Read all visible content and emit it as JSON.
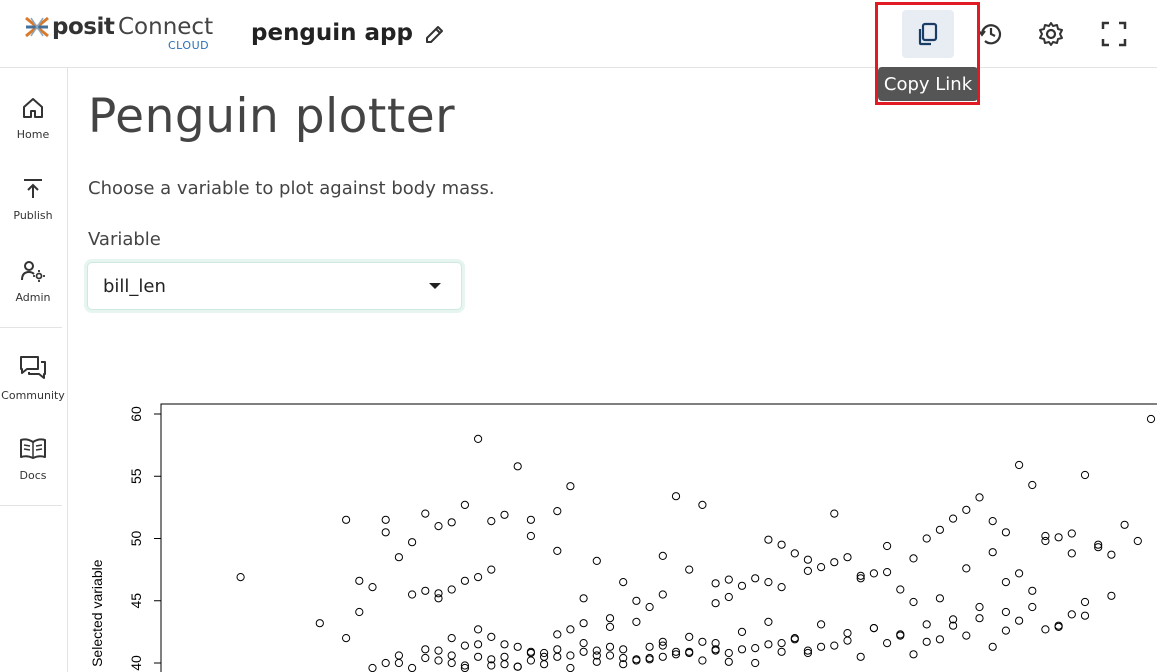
{
  "header": {
    "logo_posit": "posit",
    "logo_connect": "Connect",
    "logo_cloud": "CLOUD",
    "app_title": "penguin app",
    "tooltip": "Copy Link",
    "icons": [
      "edit-icon",
      "copy-icon",
      "history-icon",
      "gear-icon",
      "fullscreen-icon"
    ]
  },
  "sidebar": {
    "items": [
      {
        "label": "Home",
        "icon": "home-icon"
      },
      {
        "label": "Publish",
        "icon": "upload-icon"
      },
      {
        "label": "Admin",
        "icon": "admin-icon"
      },
      {
        "label": "Community",
        "icon": "chat-icon"
      },
      {
        "label": "Docs",
        "icon": "book-icon"
      }
    ]
  },
  "main": {
    "title": "Penguin plotter",
    "description": "Choose a variable to plot against body mass.",
    "variable_label": "Variable",
    "variable_value": "bill_len"
  },
  "chart_data": {
    "type": "scatter",
    "title": "",
    "xlabel": "",
    "ylabel": "Selected variable",
    "ylim": [
      39.5,
      61
    ],
    "yticks": [
      40,
      45,
      50,
      55,
      60
    ],
    "xlim": [
      2700,
      6300
    ],
    "grid": false,
    "x": [
      2850,
      3150,
      3950,
      4050,
      3400,
      3350,
      3550,
      3600,
      3650,
      3800,
      3750,
      3700,
      3900,
      3850,
      3950,
      3450,
      3500,
      3300,
      3250,
      3400,
      4050,
      4100,
      4150,
      4200,
      3700,
      3750,
      3800,
      3500,
      3550,
      3600,
      3650,
      4250,
      4300,
      4350,
      4450,
      4500,
      4550,
      4600,
      4650,
      4700,
      4750,
      4800,
      4850,
      4900,
      4950,
      5000,
      5050,
      5100,
      5150,
      5200,
      5250,
      5300,
      5350,
      5400,
      5450,
      5500,
      5550,
      5600,
      5650,
      5700,
      5750,
      5800,
      5850,
      5900,
      5950,
      6000,
      6050,
      6100,
      6150,
      6200,
      6250,
      6300,
      4400,
      4450,
      4650,
      4700,
      4850,
      4900,
      5000,
      5100,
      5200,
      5300,
      5400,
      5500,
      5600,
      5700,
      5750,
      5800,
      5900,
      6000,
      6100,
      3750,
      3850,
      3950,
      4050,
      4150,
      4250,
      4350,
      4450,
      4550,
      4650,
      3600,
      3650,
      3700,
      3800,
      3900,
      4000,
      4100,
      4200,
      4300,
      4400,
      3450,
      3550,
      3650,
      3750,
      3850,
      3950,
      4050,
      4150,
      4250,
      4350,
      4450,
      4550,
      4650,
      4750,
      4850,
      4950,
      5050,
      5150,
      5250,
      5350,
      5450,
      5550,
      5650,
      5750,
      5850,
      5950,
      6050,
      6150,
      3600,
      3700,
      3800,
      3900,
      4000,
      4100,
      4200,
      4300,
      4400,
      4500,
      4600,
      4700,
      4800,
      4900,
      5000,
      5100,
      5200,
      5300,
      5400,
      5500,
      5600,
      5700,
      5800,
      5900,
      6000,
      3300,
      3400,
      3500,
      3600,
      3700,
      3800,
      3900,
      4000,
      4100,
      4200,
      4300,
      4400,
      4500,
      4600,
      4700,
      4800,
      4900,
      5000,
      3250,
      3350,
      3450,
      3550,
      3650,
      3750,
      3850,
      3950,
      4050,
      4150,
      4250,
      4350,
      4450,
      4550,
      4650,
      4750,
      4850,
      4950,
      5050,
      5150,
      5250,
      5350,
      5450,
      5550,
      5650,
      5750,
      5850,
      5950,
      6050
    ],
    "y": [
      46.9,
      43.2,
      50.2,
      52.2,
      51.5,
      46.1,
      52.0,
      51.0,
      51.3,
      51.4,
      58.0,
      52.7,
      55.8,
      51.9,
      51.5,
      48.5,
      49.7,
      46.6,
      51.5,
      50.5,
      49.0,
      54.2,
      45.2,
      48.2,
      46.6,
      46.9,
      47.5,
      45.5,
      45.8,
      45.6,
      45.9,
      43.6,
      46.5,
      45.0,
      48.6,
      53.4,
      47.5,
      52.7,
      46.4,
      46.7,
      46.2,
      46.8,
      49.9,
      49.5,
      48.8,
      47.4,
      47.7,
      52.0,
      48.5,
      47.0,
      47.2,
      49.4,
      45.9,
      48.4,
      50.0,
      50.7,
      51.6,
      52.3,
      53.3,
      51.4,
      50.5,
      55.9,
      54.3,
      49.8,
      50.1,
      50.4,
      55.1,
      49.5,
      48.7,
      51.1,
      49.8,
      59.6,
      44.5,
      45.5,
      44.8,
      45.3,
      46.5,
      46.1,
      48.3,
      48.1,
      46.8,
      47.3,
      44.9,
      45.2,
      47.6,
      48.9,
      46.5,
      47.2,
      50.2,
      48.8,
      49.3,
      42.7,
      41.5,
      40.8,
      42.3,
      43.2,
      42.9,
      43.3,
      41.7,
      40.9,
      41.1,
      41.0,
      40.6,
      41.4,
      42.1,
      41.3,
      40.8,
      42.7,
      40.6,
      41.1,
      40.3,
      40.6,
      41.1,
      42.0,
      41.5,
      40.5,
      40.9,
      41.1,
      41.6,
      41.3,
      40.2,
      40.5,
      42.1,
      41.6,
      42.5,
      43.3,
      42.0,
      43.1,
      41.8,
      42.8,
      42.3,
      43.1,
      43.5,
      44.5,
      42.6,
      45.8,
      43.0,
      44.9,
      45.4,
      45.2,
      39.6,
      39.8,
      39.7,
      39.9,
      39.6,
      40.1,
      39.9,
      40.4,
      40.7,
      40.2,
      40.8,
      40.0,
      40.9,
      41.0,
      41.4,
      40.5,
      41.6,
      40.7,
      41.9,
      42.2,
      41.3,
      43.4,
      42.7,
      43.9,
      44.1,
      40.0,
      39.6,
      40.2,
      39.8,
      40.3,
      39.7,
      40.5,
      40.6,
      41.0,
      40.4,
      41.3,
      40.9,
      41.7,
      40.1,
      41.2,
      41.6,
      40.8,
      42.0,
      39.6,
      40.0,
      40.4,
      40.0,
      40.5,
      39.9,
      40.2,
      40.5,
      40.9,
      40.6,
      40.3,
      41.4,
      40.8,
      41.0,
      41.1,
      41.5,
      41.9,
      41.3,
      42.4,
      42.8,
      42.2,
      41.7,
      43.0,
      43.6,
      44.1,
      44.5,
      42.9,
      43.8,
      44.2
    ]
  }
}
